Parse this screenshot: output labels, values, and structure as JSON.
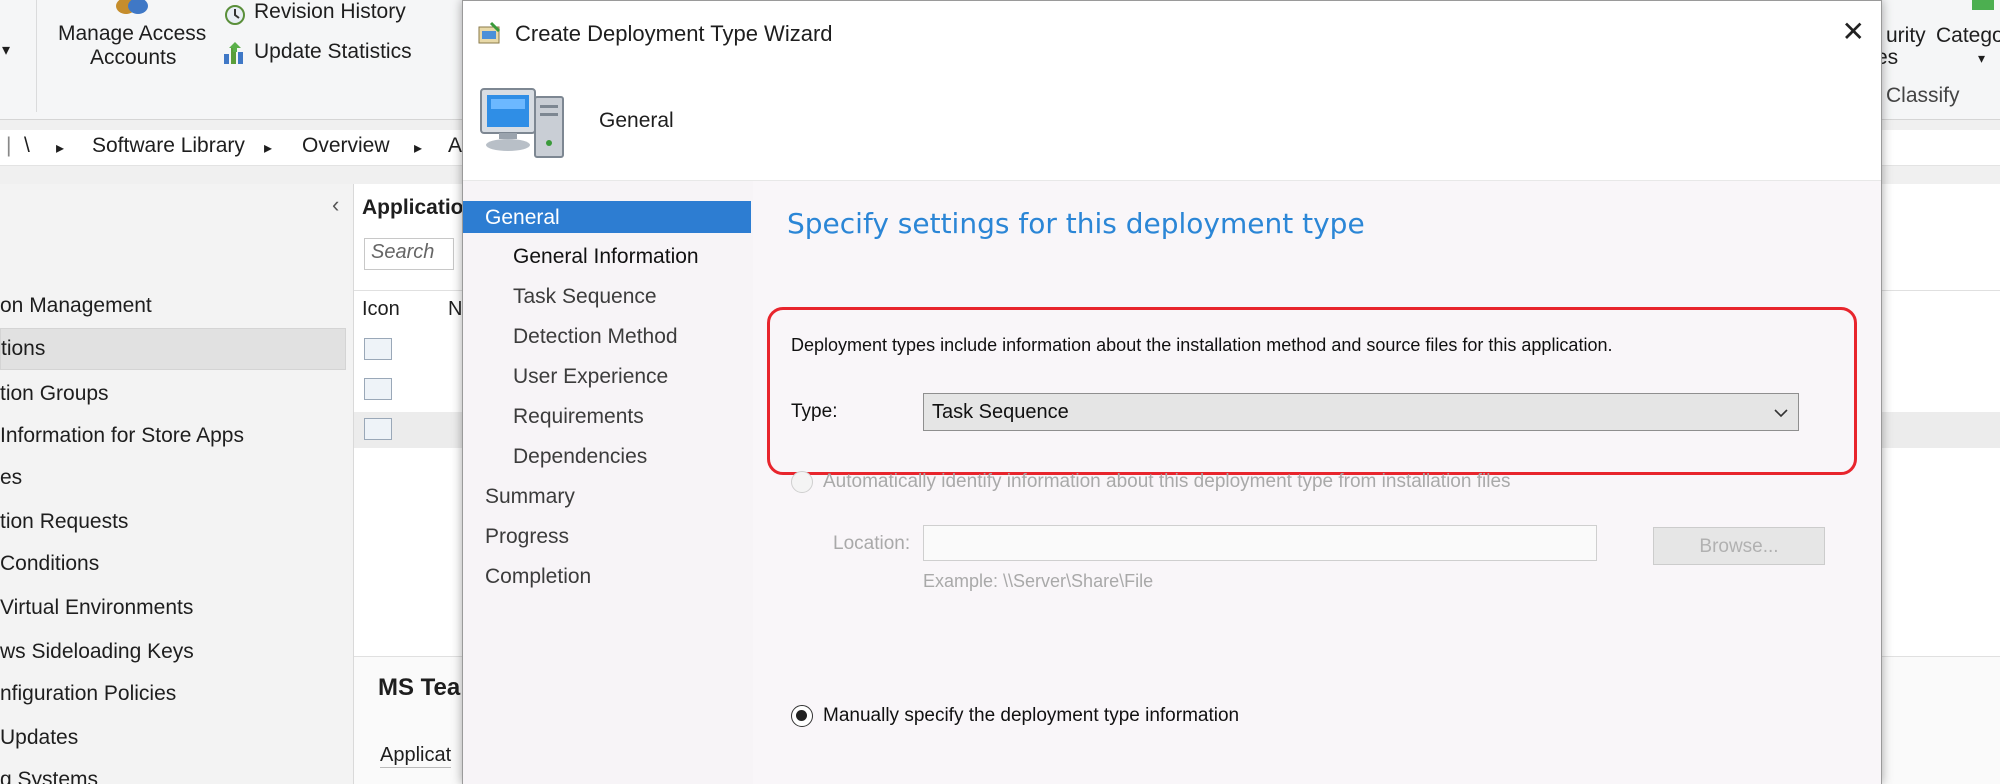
{
  "ribbon": {
    "manage_access_line1": "Manage Access",
    "manage_access_line2": "Accounts",
    "revision_history": "Revision History",
    "update_statistics": "Update Statistics",
    "security_fragment_1": "urity",
    "security_fragment_2": "es",
    "category_fragment": "Catego",
    "classify_group": "Classify",
    "dropdown_glyph": "▾"
  },
  "breadcrumb": {
    "root": "\\",
    "item1": "Software Library",
    "item2": "Overview",
    "item3": "A",
    "sep": "▸"
  },
  "nav": {
    "collapse": "‹",
    "items": [
      "on Management",
      "tions",
      "tion Groups",
      " Information for Store Apps",
      "es",
      "tion Requests",
      "Conditions",
      "Virtual Environments",
      "ws Sideloading Keys",
      "nfiguration Policies",
      "Updates",
      "g Systems"
    ]
  },
  "list": {
    "header": "Applicatio",
    "search_placeholder": "Search",
    "col_icon": "Icon",
    "col_name": "N",
    "detail_title": "MS Tea",
    "detail_tab": "Applicat"
  },
  "wizard": {
    "title": "Create Deployment Type Wizard",
    "close": "✕",
    "header": "General",
    "steps": {
      "general": "General",
      "general_information": "General Information",
      "task_sequence": "Task Sequence",
      "detection_method": "Detection Method",
      "user_experience": "User Experience",
      "requirements": "Requirements",
      "dependencies": "Dependencies",
      "summary": "Summary",
      "progress": "Progress",
      "completion": "Completion"
    },
    "body": {
      "title": "Specify settings for this deployment type",
      "description": "Deployment types include information about the installation method and source files for this application.",
      "type_label": "Type:",
      "type_value": "Task Sequence",
      "auto_identify": "Automatically identify information about this deployment type from installation files",
      "location_label": "Location:",
      "location_value": "",
      "browse": "Browse...",
      "example": "Example: \\\\Server\\Share\\File",
      "manual": "Manually specify the deployment type information"
    }
  },
  "colors": {
    "accent": "#2d7dd2",
    "title_blue": "#2b86d6",
    "highlight_red": "#e8252d"
  }
}
